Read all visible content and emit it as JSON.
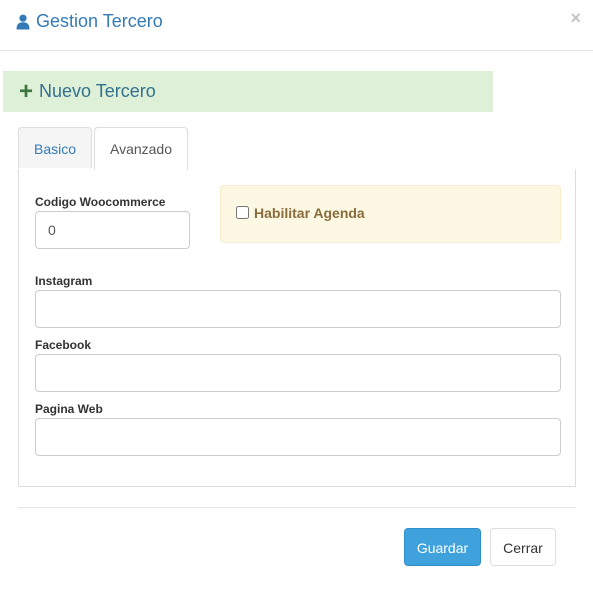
{
  "modal": {
    "title": "Gestion Tercero",
    "close_glyph": "×",
    "icon": "user-icon"
  },
  "banner": {
    "plus_glyph": "+",
    "title": "Nuevo Tercero",
    "colors": {
      "background": "#dff0d8",
      "text": "#31708f",
      "icon": "#3c763d"
    }
  },
  "tabs": [
    {
      "label": "Basico",
      "active": false
    },
    {
      "label": "Avanzado",
      "active": true
    }
  ],
  "form": {
    "codigo_woocommerce": {
      "label": "Codigo Woocommerce",
      "value": "0"
    },
    "habilitar_agenda": {
      "label": "Habilitar Agenda",
      "checked": false
    },
    "instagram": {
      "label": "Instagram",
      "value": ""
    },
    "facebook": {
      "label": "Facebook",
      "value": ""
    },
    "pagina_web": {
      "label": "Pagina Web",
      "value": ""
    }
  },
  "footer": {
    "save_label": "Guardar",
    "close_label": "Cerrar",
    "colors": {
      "primary": "#3fa2dd"
    }
  }
}
